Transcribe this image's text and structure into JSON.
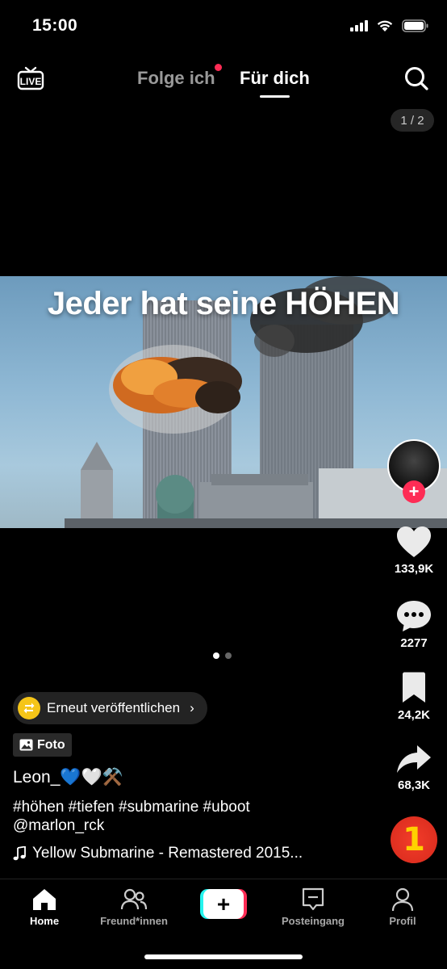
{
  "status_bar": {
    "time": "15:00"
  },
  "top_nav": {
    "live_label": "LIVE",
    "tab_following": "Folge ich",
    "tab_for_you": "Für dich"
  },
  "post": {
    "page_counter": "1 / 2",
    "photo_caption": "Jeder hat seine HÖHEN",
    "likes": "133,9K",
    "comments": "2277",
    "saves": "24,2K",
    "shares": "68,3K",
    "repost_label": "Erneut veröffentlichen",
    "photo_badge": "Foto",
    "username": "Leon_💙🤍⚒️",
    "hashtags": "#höhen #tiefen #submarine #uboot",
    "mention": "@marlon_rck",
    "music": "Yellow Submarine - Remastered 2015...",
    "music_disc_label": "1"
  },
  "bottom_nav": {
    "home": "Home",
    "friends": "Freund*innen",
    "inbox": "Posteingang",
    "profile": "Profil"
  },
  "colors": {
    "accent": "#fe2c55",
    "create_cyan": "#25f4ee",
    "repost_yellow": "#f5c518"
  }
}
